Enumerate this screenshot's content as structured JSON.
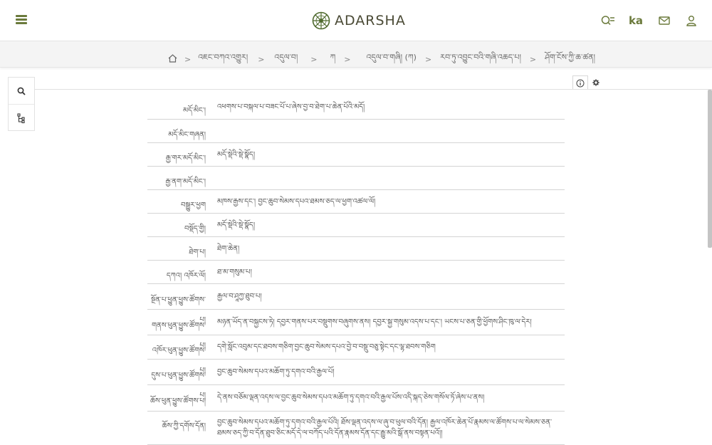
{
  "header": {
    "brand": "ADARSHA",
    "ka_label": "ka",
    "accent": "#6b7a3c"
  },
  "breadcrumb": [
    "འཇང་བཀའ་འགྱུར།",
    "འདུལ་བ།",
    "ཀ",
    "འདུལ་བ་གཞི། (ཀ)",
    "རབ་ཏུ་འབྱུང་བའི་གཞི་འཆད་པ།",
    "ཤོག་ངོས་ཀྱི་ཆ་ཚན།"
  ],
  "metadata": [
    {
      "label": "མདོ་མིང་།",
      "value": "འཕགས་པ་བསྐལ་པ་བཟང་པོ་པ་ཞེས་བྱ་བ་ཐེག་པ་ཆེན་པོའི་མདོ།"
    },
    {
      "label": "མདོ་མིང་གཞན།",
      "value": ""
    },
    {
      "label": "རྒྱ་གར་མདོ་མིང་།",
      "value": "མདོ་སྡེའི་སྡེ་སྣོད།"
    },
    {
      "label": "རྒྱ་ནག་མདོ་མིང་།",
      "value": ""
    },
    {
      "label": "བསྒྱུར་ཕྱག",
      "value": "མཁས་རྒྱས་དང་། བྱང་ཆུབ་སེམས་དཔའ་ཐམས་ཅད་ལ་ཕྱག་འཚལ་ལོ།"
    },
    {
      "label": "བསྡོད་གྱི།",
      "value": "མདོ་སྡེའི་སྡེ་སྣོད།"
    },
    {
      "label": "ཐེག་པ།",
      "value": "ཐེག་ཆེན།"
    },
    {
      "label": "དཀའ། འཁོར་ལོ།",
      "value": "ཐ་མ་གསུམ་པ།"
    },
    {
      "label": "སྔོན་པ་ཕྱུན་ཕྱུས་ཚོགས་པ།",
      "value": "རྒྱལ་བ་ཤཱཀྱ་ཐུབ་པ།"
    },
    {
      "label": "གནས་ཕུན་ཕྱུས་ཚོགས་པ།",
      "value": "མཉན་ཡོད་ན་བསྐྱངས་ཏེ། དབྱར་གནས་པར་བསྡུགས་བཞུགས་ནས། དབྱར་སྐྱ་གསུམ་འདས་པ་དང་། ཡངས་པ་ཅན་གྱི་ཕྱོགས་ཤིང་ཁུ་ལ་དེར།"
    },
    {
      "label": "འཁོར་ཕུན་ཕྱུས་ཚོགས་པ།",
      "value": "དགེ་སློང་འབུམ་དང་ཐབས་གཅིག་བྱང་ཆུབ་སེམས་དཔའ་བྱེ་བ་བསྡུ་བཅུ་སྟེང་དང་ལྷ་ཐབས་གཅིག"
    },
    {
      "label": "དུས་པ་ཕུན་ཕྱུས་ཚོགས་པ།",
      "value": "བྱང་ཆུབ་སེམས་དཔའ་མཆོག་ཏུ་དགའ་བའི་རྒྱལ་པོ།"
    },
    {
      "label": "ཆོས་ཕུན་ཕྱུས་ཚོགས་པ།",
      "value": "དེ་ནས་བཅོམ་ལྡན་འདས་ལ་བྱང་ཆུབ་སེམས་དཔའ་མཆོག་ཏུ་དགའ་བའི་རྒྱལ་པོས་འདི་སྐད་ཅེས་གསོལ་ཏོ་ཞེས་པ་ནས།"
    },
    {
      "label": "ཆོས་ཀྱི་དགོས་དོན།",
      "value": "བྱང་ཆུབ་སེམས་དཔའ་མཆོག་ཏུ་དགའ་བའི་རྒྱལ་པོའི། ཐོས་ལྡན་འདས་ལ་ཞུ་བ་ཕུལ་བའི་དོན། རྒྱལ་འཁོར་ཆེན་པོ་རྣམས་ལ་ཚོགས་པ་ལ་སེམས་ཅན་ཐམས་ཅད་ཀྱི་བ་དོན་ཐུབ་ཅིང་མདོ་དེ་ལ་བཀོད་པའི་དོན་རྣམས་དོན་དང་རྒྱུ་མའི་སྒོ་ནས་བསྟན་པའོ།།"
    }
  ]
}
